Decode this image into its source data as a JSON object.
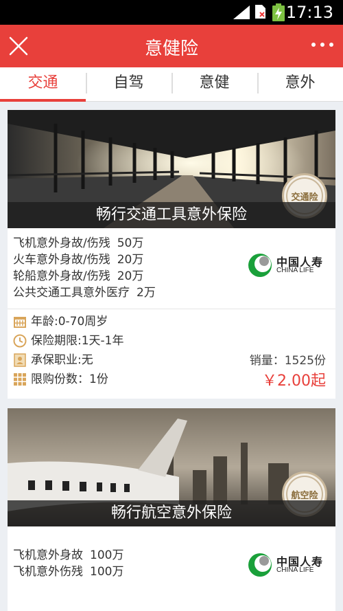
{
  "status_bar": {
    "time": "17:13"
  },
  "header": {
    "title": "意健险"
  },
  "tabs": [
    {
      "label": "交通"
    },
    {
      "label": "自驾"
    },
    {
      "label": "意健"
    },
    {
      "label": "意外"
    }
  ],
  "products": [
    {
      "title": "畅行交通工具意外保险",
      "seal": "交通险",
      "coverage": [
        {
          "name": "飞机意外身故/伤残",
          "amount": "50万"
        },
        {
          "name": "火车意外身故/伤残",
          "amount": "20万"
        },
        {
          "name": "轮船意外身故/伤残",
          "amount": "20万"
        },
        {
          "name": "公共交通工具意外医疗",
          "amount": "2万"
        }
      ],
      "insurer_cn": "中国人寿",
      "insurer_en": "CHINA LIFE",
      "details": {
        "age": "年龄:0-70周岁",
        "period": "保险期限:1天-1年",
        "occupation": "承保职业:无",
        "limit": "限购份数：1份"
      },
      "sales": "销量：1525份",
      "price": "￥2.00起"
    },
    {
      "title": "畅行航空意外保险",
      "seal": "航空险",
      "coverage": [
        {
          "name": "飞机意外身故",
          "amount": "100万"
        },
        {
          "name": "飞机意外伤残",
          "amount": "100万"
        }
      ],
      "insurer_cn": "中国人寿",
      "insurer_en": "CHINA LIFE"
    }
  ]
}
